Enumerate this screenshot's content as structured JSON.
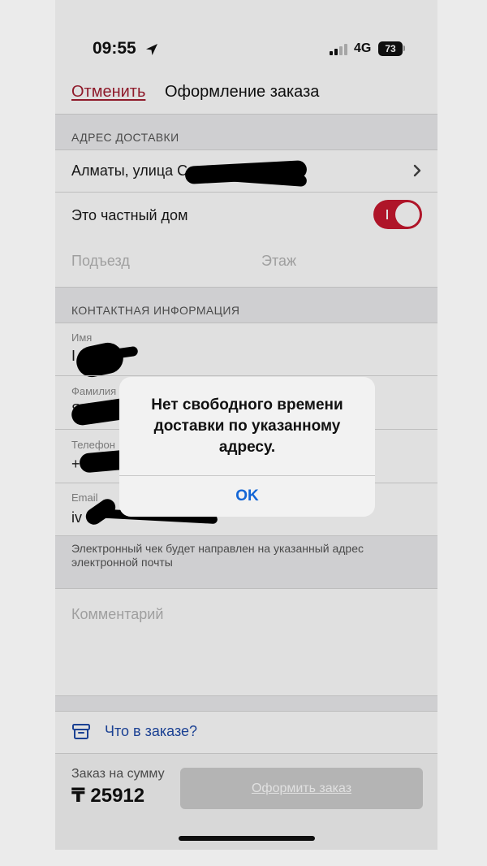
{
  "status_bar": {
    "time": "09:55",
    "network": "4G",
    "battery": "73"
  },
  "header": {
    "cancel_label": "Отменить",
    "title": "Оформление заказа"
  },
  "delivery": {
    "section_title": "АДРЕС ДОСТАВКИ",
    "address": "Алматы, улица С",
    "private_house_label": "Это частный дом",
    "private_house_on": true,
    "entrance_placeholder": "Подъезд",
    "floor_placeholder": "Этаж"
  },
  "contact": {
    "section_title": "КОНТАКТНАЯ ИНФОРМАЦИЯ",
    "name_label": "Имя",
    "name_value": "I",
    "surname_label": "Фамилия",
    "surname_value": "S",
    "phone_label": "Телефон",
    "phone_value": "+",
    "email_label": "Email",
    "email_value": "iv",
    "note": "Электронный чек будет направлен на указанный адрес электронной почты"
  },
  "comment": {
    "placeholder": "Комментарий"
  },
  "order_link": "Что в заказе?",
  "footer": {
    "sum_label": "Заказ на сумму",
    "sum_value": "₸ 25912",
    "submit_label": "Оформить заказ"
  },
  "alert": {
    "message": "Нет свободного времени доставки по указанному адресу.",
    "ok_label": "OK"
  },
  "colors": {
    "accent_red": "#c8192f",
    "link_blue": "#1f4aa8",
    "alert_button_blue": "#1366d6"
  }
}
